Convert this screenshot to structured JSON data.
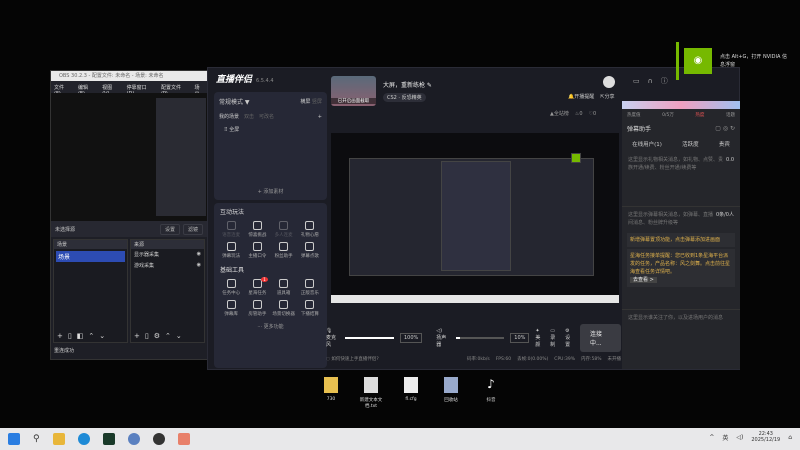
{
  "obs": {
    "title": "OBS 30.2.3 - 配置文件: 未命名 - 场景: 未命名",
    "menu": [
      "文件(F)",
      "编辑(E)",
      "视图(V)",
      "停靠窗口(D)",
      "配置文件(P)",
      "场景"
    ],
    "no_source": "未选择源",
    "settings_btn": "设置",
    "filter_btn": "滤镜",
    "scenes_header": "场景",
    "scenes": [
      "场景"
    ],
    "sources_header": "来源",
    "sources": [
      "显示器采集",
      "游戏采集"
    ],
    "status": "重连成功"
  },
  "zb": {
    "app_name": "直播伴侣",
    "version": "6.5.4.4",
    "mode": "常规模式",
    "orientation": [
      "横屏",
      "竖屏"
    ],
    "scene_tabs": [
      "我的场景",
      "双击",
      "可改名"
    ],
    "scene_items": [
      "全屏"
    ],
    "add_material": "添加素材",
    "stream_title": "大屏，重新练枪",
    "cover_label": "已开启画面截取",
    "category": "CS2 · 反恐精英",
    "remind": "开播提醒",
    "share": "分享",
    "all_station": "全站榜",
    "likes": "0",
    "hearts": "0",
    "interactive_title": "互动玩法",
    "interactive": [
      "语音连麦",
      "惊喜挑战",
      "多人连麦",
      "礼物心愿",
      "弹幕玩法",
      "主播口令",
      "粉丝助手",
      "弹幕点歌"
    ],
    "basic_title": "基础工具",
    "basic": [
      "任务中心",
      "星海任务",
      "道具箱",
      "正版音乐",
      "弹幕库",
      "房管助手",
      "场景切换器",
      "下播结算"
    ],
    "badge": "1",
    "more": "更多功能",
    "mic_label": "麦克风",
    "mic_volume": "100%",
    "speaker_label": "扬声器",
    "speaker_volume": "10%",
    "mic_level": 100,
    "speaker_level": 10,
    "beauty": "美颜",
    "record": "录制",
    "settings": "设置",
    "connect": "连接中...",
    "help": "如何快速上手直播伴侣?",
    "status": [
      "码率:0kb/s",
      "FPS:60",
      "丢帧:0(0.00%)",
      "CPU:39%",
      "内存:58%",
      "未开播"
    ]
  },
  "right": {
    "stats": [
      "热度值",
      "0/5万",
      "热度",
      "话题"
    ],
    "title": "弹幕助手",
    "tabs": [
      "在线用户(1)",
      "活跃度",
      "贵宾"
    ],
    "gift_msg": "这里显示礼物相关消息，如礼物、点赞、贵族开通/续费、粉丝开通/续费等",
    "gift_value": "0.0",
    "danmu_count": "0条/0人",
    "danmu_msg": "这里显示弹幕相关消息，如弹幕、直播间消息、粉丝牌升级等",
    "notice1": "新增弹幕置顶功能，点击弹幕添加进画面",
    "notice2": "星海任务接单提醒：您已收到1条星海平台派发的任务，产品名称：风之剑舞。点击前往星海查看任务详情吧。",
    "view_btn": "去查看 >",
    "follow_msg": "这里显示谁关注了你，以及进场用户的消息"
  },
  "nvidia": {
    "text": "点击 Alt+G，打开 NVIDIA 信息浮窗",
    "color": "#76b900"
  },
  "desktop": [
    {
      "label": "730",
      "icon": "folder-icon"
    },
    {
      "label": "新建文本文档.txt",
      "icon": "text-file-icon"
    },
    {
      "label": "fl.cfg",
      "icon": "file-icon"
    },
    {
      "label": "回收站",
      "icon": "recycle-bin-icon"
    },
    {
      "label": "抖音",
      "icon": "tiktok-icon"
    }
  ],
  "taskbar": {
    "time": "22:43",
    "date": "2025/12/19",
    "ime": "英"
  }
}
